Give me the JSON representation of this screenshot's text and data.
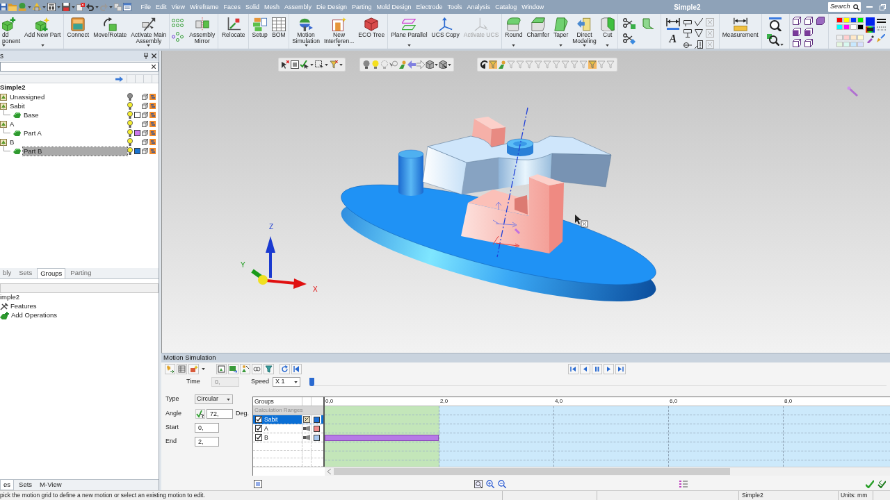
{
  "title_bar": {
    "menus": [
      "File",
      "Edit",
      "View",
      "Wireframe",
      "Faces",
      "Solid",
      "Mesh",
      "Assembly",
      "Die Design",
      "Parting",
      "Mold Design",
      "Electrode",
      "Tools",
      "Analysis",
      "Catalog",
      "Window"
    ],
    "title": "Simple2",
    "search": {
      "placeholder": "Search"
    }
  },
  "ribbon": {
    "groups": [
      {
        "kind": "buttons",
        "buttons": [
          {
            "label": "dd\nponent",
            "menu": true,
            "disabled": false
          },
          {
            "label": "Add New Part",
            "menu": true,
            "disabled": false
          }
        ]
      },
      {
        "kind": "buttons",
        "buttons": [
          {
            "label": "Connect",
            "menu": false,
            "disabled": false
          },
          {
            "label": "Move/Rotate",
            "menu": false,
            "disabled": false
          },
          {
            "label": "Activate Main\nAssembly",
            "menu": true,
            "disabled": false
          }
        ]
      },
      {
        "kind": "buttons",
        "buttons": [
          {
            "label": "Assembly\nMirror",
            "menu": false,
            "disabled": false
          }
        ]
      },
      {
        "kind": "buttons",
        "buttons": [
          {
            "label": "Relocate",
            "menu": false,
            "disabled": false
          }
        ]
      },
      {
        "kind": "buttons",
        "buttons": [
          {
            "label": "Setup",
            "menu": false,
            "disabled": false
          },
          {
            "label": "BOM",
            "menu": false,
            "disabled": false
          }
        ]
      },
      {
        "kind": "buttons",
        "buttons": [
          {
            "label": "Motion\nSimulation",
            "menu": true,
            "disabled": false
          },
          {
            "label": "New\nInterferen...",
            "menu": true,
            "disabled": false
          },
          {
            "label": "ECO Tree",
            "menu": false,
            "disabled": false
          }
        ]
      },
      {
        "kind": "buttons",
        "buttons": [
          {
            "label": "Plane Parallel",
            "menu": true,
            "disabled": false
          },
          {
            "label": "UCS Copy",
            "menu": false,
            "disabled": false
          },
          {
            "label": "Activate UCS",
            "menu": false,
            "disabled": true
          }
        ]
      },
      {
        "kind": "buttons",
        "buttons": [
          {
            "label": "Round",
            "menu": true,
            "disabled": false
          },
          {
            "label": "Chamfer",
            "menu": false,
            "disabled": false
          },
          {
            "label": "Taper",
            "menu": true,
            "disabled": false
          },
          {
            "label": "Direct\nModeling",
            "menu": true,
            "disabled": false
          },
          {
            "label": "Cut",
            "menu": true,
            "disabled": false
          }
        ]
      },
      {
        "kind": "icons"
      },
      {
        "kind": "icons",
        "glyph": "A"
      },
      {
        "kind": "buttons",
        "buttons": [
          {
            "label": "Measurement",
            "menu": false,
            "disabled": false
          }
        ]
      },
      {
        "kind": "icons"
      },
      {
        "kind": "icons"
      },
      {
        "kind": "icons"
      }
    ]
  },
  "assembly_panel": {
    "title": "s",
    "tree": {
      "label": "Simple2",
      "selected": false,
      "children": [
        {
          "label": "Unassigned",
          "kind": "group",
          "lit": false,
          "selected": false
        },
        {
          "label": "Sabit",
          "kind": "group",
          "lit": true,
          "selected": false,
          "children": [
            {
              "label": "Base",
              "kind": "part",
              "lit": true,
              "color": "#ffffff",
              "selected": false
            }
          ]
        },
        {
          "label": "A",
          "kind": "group",
          "lit": true,
          "selected": false,
          "children": [
            {
              "label": "Part A",
              "kind": "part",
              "lit": true,
              "color": "#cc77ee",
              "selected": false
            }
          ]
        },
        {
          "label": "B",
          "kind": "group",
          "lit": true,
          "selected": false,
          "children": [
            {
              "label": "Part B",
              "kind": "part",
              "lit": true,
              "color": "#1a73d0",
              "selected": true
            }
          ]
        }
      ]
    },
    "tabs": [
      {
        "label": "bly",
        "selected": false
      },
      {
        "label": "Sets",
        "selected": false
      },
      {
        "label": "Groups",
        "selected": true
      },
      {
        "label": "Parting",
        "selected": false
      }
    ]
  },
  "feature_panel": {
    "tree": {
      "label": "imple2",
      "children": [
        {
          "label": "Features",
          "kind": "features"
        },
        {
          "label": "Add Operations",
          "kind": "operations"
        }
      ]
    },
    "tabs": [
      {
        "label": "es",
        "selected": true
      },
      {
        "label": "Sets",
        "selected": false
      },
      {
        "label": "M-View",
        "selected": false
      }
    ]
  },
  "viewport": {
    "triad": {
      "x": "X",
      "y": "Y",
      "z": "Z"
    }
  },
  "motion_simulation": {
    "title": "Motion Simulation",
    "time": {
      "label": "Time",
      "value": "0,",
      "disabled": true
    },
    "speed": {
      "label": "Speed",
      "value": "X 1"
    },
    "time_slider": {
      "level": 0
    },
    "type": {
      "label": "Type",
      "value": "Circular"
    },
    "angle": {
      "label": "Angle",
      "value": "72,",
      "unit": "Deg."
    },
    "start": {
      "label": "Start",
      "value": "0,"
    },
    "end": {
      "label": "End",
      "value": "2,"
    },
    "grid": {
      "header": "Groups",
      "subheader": "Calculation Ranges",
      "ticks": [
        "0,0",
        "2,0",
        "4,0",
        "6,0",
        "8,0"
      ],
      "rows": [
        {
          "name": "Sabit",
          "checked": true,
          "selected": true,
          "fixed": true,
          "color": "#1a6fd8",
          "has_motion": false
        },
        {
          "name": "A",
          "checked": true,
          "selected": false,
          "fixed": false,
          "color": "#f08a8a",
          "has_motion": false
        },
        {
          "name": "B",
          "checked": true,
          "selected": false,
          "fixed": false,
          "color": "#a8c8f0",
          "has_motion": true
        }
      ]
    }
  },
  "status_bar": {
    "message": "pick the motion grid to define a new motion or select an existing motion to edit.",
    "document": "Simple2",
    "units": "Units: mm"
  }
}
